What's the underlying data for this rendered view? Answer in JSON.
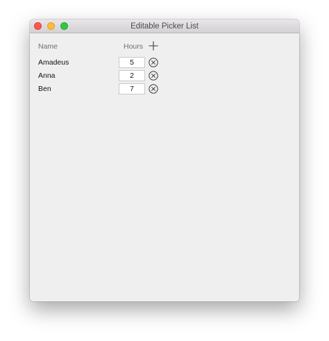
{
  "window": {
    "title": "Editable Picker List"
  },
  "list": {
    "header_name": "Name",
    "header_hours": "Hours",
    "add_icon": "plus-icon",
    "remove_icon": "circled-x-icon",
    "rows": [
      {
        "name": "Amadeus",
        "hours": "5"
      },
      {
        "name": "Anna",
        "hours": "2"
      },
      {
        "name": "Ben",
        "hours": "7"
      }
    ]
  },
  "colors": {
    "close": "#fc5753",
    "minimize": "#fdbc40",
    "maximize": "#33c748"
  }
}
